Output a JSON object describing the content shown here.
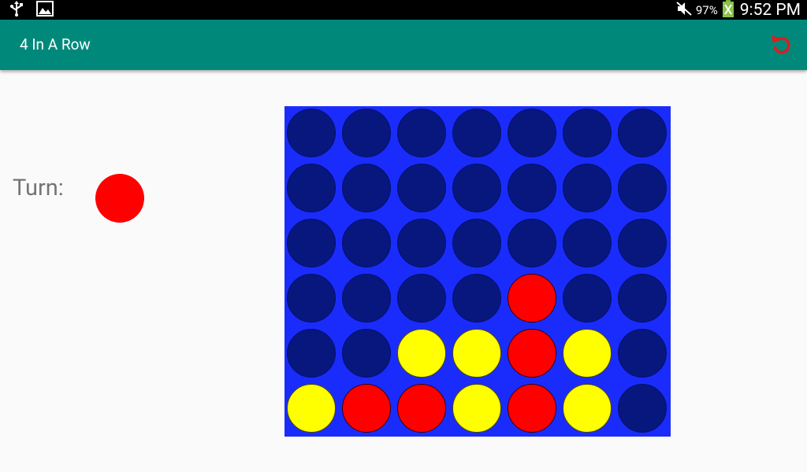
{
  "status_bar": {
    "battery_percent": "97%",
    "time": "9:52 PM",
    "icons": [
      "usb-icon",
      "image-icon",
      "mute-icon",
      "battery-charging-icon"
    ]
  },
  "app_bar": {
    "title": "4 In A Row",
    "reset_icon": "reset-icon",
    "accent": "#00897b"
  },
  "turn": {
    "label": "Turn:",
    "current_player": "red"
  },
  "board": {
    "rows": 6,
    "cols": 7,
    "colors": {
      "board": "#1a2cfc",
      "empty": "#07177d",
      "red": "#ff0000",
      "yellow": "#ffff00"
    },
    "cells": [
      [
        "empty",
        "empty",
        "empty",
        "empty",
        "empty",
        "empty",
        "empty"
      ],
      [
        "empty",
        "empty",
        "empty",
        "empty",
        "empty",
        "empty",
        "empty"
      ],
      [
        "empty",
        "empty",
        "empty",
        "empty",
        "empty",
        "empty",
        "empty"
      ],
      [
        "empty",
        "empty",
        "empty",
        "empty",
        "red",
        "empty",
        "empty"
      ],
      [
        "empty",
        "empty",
        "yellow",
        "yellow",
        "red",
        "yellow",
        "empty"
      ],
      [
        "yellow",
        "red",
        "red",
        "yellow",
        "red",
        "yellow",
        "empty"
      ]
    ]
  }
}
